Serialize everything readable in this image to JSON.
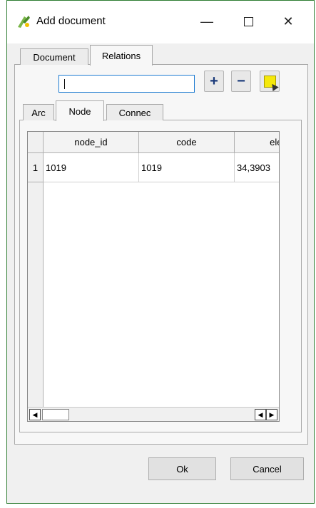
{
  "window": {
    "title": "Add document",
    "minimize_glyph": "—",
    "close_glyph": "✕"
  },
  "main_tabs": [
    {
      "label": "Document",
      "active": false
    },
    {
      "label": "Relations",
      "active": true
    }
  ],
  "search": {
    "value": "",
    "placeholder": ""
  },
  "toolbar": {
    "add_label": "+",
    "remove_label": "−",
    "select_icon": "select-feature-icon"
  },
  "sub_tabs": [
    {
      "label": "Arc",
      "active": false
    },
    {
      "label": "Node",
      "active": true
    },
    {
      "label": "Connec",
      "active": false
    }
  ],
  "table": {
    "columns": [
      "node_id",
      "code",
      "elev"
    ],
    "rows": [
      {
        "row_number": "1",
        "cells": [
          "1019",
          "1019",
          "34,3903"
        ]
      }
    ]
  },
  "scrollbar": {
    "left_arrow": "◀",
    "right_arrow_a": "◀",
    "right_arrow_b": "▶"
  },
  "buttons": {
    "ok_label": "Ok",
    "cancel_label": "Cancel"
  },
  "colors": {
    "window_border": "#2e7d32",
    "focus_border": "#1e7bd1",
    "select_icon_fill": "#f5e80a"
  }
}
